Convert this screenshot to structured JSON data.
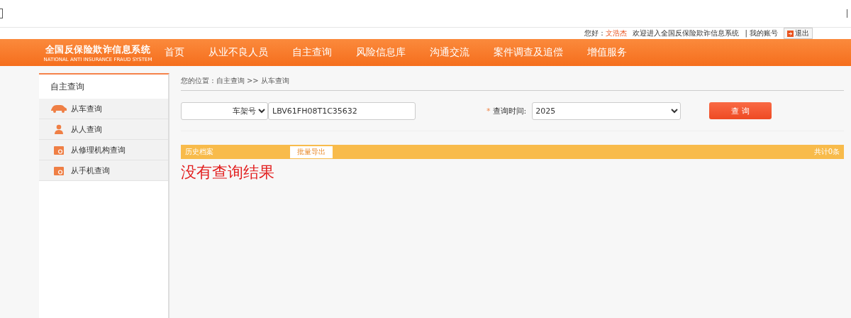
{
  "user_bar": {
    "greeting": "您好：",
    "user_name": "文浩杰",
    "welcome": "欢迎进入全国反保险欺诈信息系统",
    "account_link": "| 我的账号",
    "logout": "退出"
  },
  "logo": {
    "title": "全国反保险欺诈信息系统",
    "subtitle": "NATIONAL ANTI INSURANCE FRAUD SYSTEM"
  },
  "nav": [
    "首页",
    "从业不良人员",
    "自主查询",
    "风险信息库",
    "沟通交流",
    "案件调查及追偿",
    "增值服务"
  ],
  "sidebar": {
    "title": "自主查询",
    "items": [
      {
        "label": "从车查询",
        "kind": "car"
      },
      {
        "label": "从人查询",
        "kind": "person"
      },
      {
        "label": "从修理机构查询",
        "kind": "org"
      },
      {
        "label": "从手机查询",
        "kind": "org"
      }
    ]
  },
  "breadcrumb": "您的位置 : 自主查询 >> 从车查询",
  "search": {
    "type_select": "车架号",
    "query_value": "LBV61FH08T1C35632",
    "required_mark": "*",
    "time_label": "查询时间:",
    "time_select": "2025",
    "submit": "查 询"
  },
  "results": {
    "title": "历史档案",
    "export": "批量导出",
    "count": "共计0条",
    "empty_message": "没有查询结果"
  }
}
